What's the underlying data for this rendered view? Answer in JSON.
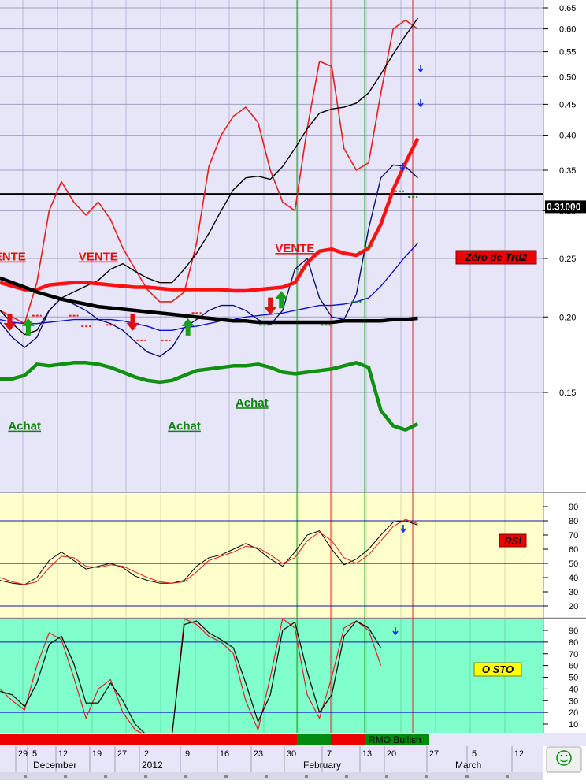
{
  "chart_data": [
    {
      "type": "line",
      "panel": "price",
      "y_scale": "log",
      "ylim": [
        0.1,
        0.66
      ],
      "y_ticks": [
        "0.65",
        "0.60",
        "0.55",
        "0.50",
        "0.45",
        "0.40",
        "0.35",
        "0.30",
        "0.25",
        "0.20",
        "0.15"
      ],
      "y_tick_values": [
        0.65,
        0.6,
        0.55,
        0.5,
        0.45,
        0.4,
        0.35,
        0.3,
        0.25,
        0.2,
        0.15
      ],
      "price_label": "0.31000",
      "price_level": 0.31,
      "legend": "Zéro de Trd2",
      "series": [
        {
          "color": "#e02020",
          "values": [
            0.205,
            0.2,
            0.195,
            0.228,
            0.3,
            0.335,
            0.31,
            0.295,
            0.31,
            0.29,
            0.26,
            0.24,
            0.222,
            0.212,
            0.212,
            0.22,
            0.265,
            0.355,
            0.4,
            0.43,
            0.445,
            0.42,
            0.35,
            0.31,
            0.3,
            0.41,
            0.53,
            0.52,
            0.38,
            0.35,
            0.36,
            0.47,
            0.6,
            0.62,
            0.6
          ]
        },
        {
          "color": "#000000",
          "values": [
            0.205,
            0.195,
            0.187,
            0.19,
            0.205,
            0.215,
            0.22,
            0.225,
            0.23,
            0.24,
            0.245,
            0.238,
            0.232,
            0.228,
            0.228,
            0.24,
            0.255,
            0.275,
            0.3,
            0.325,
            0.34,
            0.342,
            0.338,
            0.355,
            0.38,
            0.41,
            0.435,
            0.442,
            0.445,
            0.452,
            0.47,
            0.505,
            0.545,
            0.585,
            0.625
          ]
        },
        {
          "color": "#1010d0",
          "values": [
            0.198,
            0.196,
            0.195,
            0.195,
            0.196,
            0.197,
            0.198,
            0.198,
            0.198,
            0.198,
            0.197,
            0.195,
            0.193,
            0.19,
            0.19,
            0.192,
            0.193,
            0.195,
            0.197,
            0.198,
            0.2,
            0.201,
            0.202,
            0.203,
            0.205,
            0.207,
            0.209,
            0.209,
            0.21,
            0.212,
            0.215,
            0.225,
            0.238,
            0.252,
            0.265
          ]
        },
        {
          "color": "#101070",
          "values": [
            0.196,
            0.185,
            0.178,
            0.185,
            0.205,
            0.215,
            0.21,
            0.205,
            0.198,
            0.195,
            0.19,
            0.182,
            0.175,
            0.172,
            0.178,
            0.192,
            0.198,
            0.205,
            0.209,
            0.209,
            0.205,
            0.198,
            0.194,
            0.205,
            0.24,
            0.25,
            0.215,
            0.2,
            0.198,
            0.218,
            0.28,
            0.34,
            0.357,
            0.355,
            0.34
          ]
        },
        {
          "color": "#ff1010",
          "values": [
            0.228,
            0.225,
            0.222,
            0.222,
            0.226,
            0.227,
            0.228,
            0.228,
            0.227,
            0.226,
            0.225,
            0.224,
            0.224,
            0.223,
            0.222,
            0.222,
            0.222,
            0.222,
            0.222,
            0.221,
            0.221,
            0.222,
            0.223,
            0.224,
            0.228,
            0.246,
            0.257,
            0.259,
            0.255,
            0.253,
            0.26,
            0.285,
            0.325,
            0.36,
            0.395
          ]
        },
        {
          "color": "#000000",
          "values": [
            0.232,
            0.228,
            0.224,
            0.22,
            0.217,
            0.214,
            0.212,
            0.21,
            0.208,
            0.207,
            0.206,
            0.205,
            0.204,
            0.203,
            0.202,
            0.201,
            0.2,
            0.199,
            0.198,
            0.197,
            0.197,
            0.196,
            0.196,
            0.196,
            0.196,
            0.196,
            0.196,
            0.196,
            0.197,
            0.197,
            0.197,
            0.197,
            0.198,
            0.198,
            0.199
          ]
        },
        {
          "color": "#109010",
          "values": [
            0.158,
            0.158,
            0.16,
            0.167,
            0.166,
            0.167,
            0.168,
            0.168,
            0.167,
            0.165,
            0.162,
            0.159,
            0.157,
            0.156,
            0.157,
            0.16,
            0.163,
            0.164,
            0.165,
            0.166,
            0.166,
            0.167,
            0.165,
            0.162,
            0.161,
            0.162,
            0.163,
            0.164,
            0.166,
            0.168,
            0.165,
            0.14,
            0.132,
            0.13,
            0.133
          ]
        }
      ],
      "signals": [
        {
          "text": "VENTE",
          "color": "#e01010",
          "x": 0.5,
          "price": 0.248
        },
        {
          "text": "VENTE",
          "color": "#e01010",
          "x": 8.0,
          "price": 0.248
        },
        {
          "text": "VENTE",
          "color": "#e01010",
          "x": 24.0,
          "price": 0.256
        },
        {
          "text": "Achat",
          "color": "#108010",
          "x": 20.5,
          "price": 0.142
        },
        {
          "text": "Achat",
          "color": "#108010",
          "x": 2.0,
          "price": 0.13
        },
        {
          "text": "Achat",
          "color": "#108010",
          "x": 15.0,
          "price": 0.13
        }
      ],
      "arrows": [
        {
          "dir": "down",
          "color": "#e01010",
          "x": 0.8,
          "price": 0.192
        },
        {
          "dir": "up",
          "color": "#18a018",
          "x": 2.3,
          "price": 0.192
        },
        {
          "dir": "down",
          "color": "#e01010",
          "x": 10.8,
          "price": 0.192
        },
        {
          "dir": "up",
          "color": "#18a018",
          "x": 15.3,
          "price": 0.192
        },
        {
          "dir": "down",
          "color": "#e01010",
          "x": 22.0,
          "price": 0.204
        },
        {
          "dir": "up",
          "color": "#18a018",
          "x": 22.9,
          "price": 0.213
        }
      ]
    },
    {
      "type": "line",
      "panel": "rsi",
      "legend": "RSI",
      "ylim": [
        10,
        100
      ],
      "y_ticks": [
        "90",
        "80",
        "70",
        "60",
        "50",
        "40",
        "30",
        "20"
      ],
      "y_tick_values": [
        90,
        80,
        70,
        60,
        50,
        40,
        30,
        20
      ],
      "levels": [
        80,
        50,
        20
      ],
      "series": [
        {
          "color": "#000000",
          "values": [
            38,
            36,
            35,
            40,
            52,
            58,
            52,
            46,
            48,
            50,
            47,
            41,
            38,
            36,
            36,
            38,
            48,
            54,
            56,
            60,
            64,
            60,
            53,
            48,
            58,
            70,
            73,
            60,
            49,
            53,
            60,
            70,
            79,
            80,
            77
          ]
        },
        {
          "color": "#e02020",
          "values": [
            40,
            37,
            35,
            37,
            47,
            55,
            54,
            48,
            47,
            49,
            48,
            44,
            40,
            37,
            36,
            37,
            44,
            52,
            55,
            58,
            62,
            61,
            56,
            50,
            54,
            66,
            72,
            66,
            54,
            50,
            56,
            66,
            76,
            81,
            78
          ]
        }
      ]
    },
    {
      "type": "line",
      "panel": "stochastic",
      "legend": "O STO",
      "ylim": [
        0,
        105
      ],
      "y_ticks": [
        "90",
        "80",
        "70",
        "60",
        "50",
        "40",
        "30",
        "20",
        "10"
      ],
      "y_tick_values": [
        90,
        80,
        70,
        60,
        50,
        40,
        30,
        20,
        10
      ],
      "levels": [
        80,
        20
      ],
      "series": [
        {
          "color": "#e02020",
          "values": [
            40,
            30,
            22,
            60,
            88,
            82,
            50,
            15,
            40,
            48,
            20,
            5,
            0,
            0,
            0,
            100,
            95,
            85,
            80,
            70,
            30,
            5,
            50,
            100,
            92,
            35,
            15,
            50,
            92,
            98,
            90,
            60
          ]
        },
        {
          "color": "#000000",
          "values": [
            38,
            35,
            25,
            45,
            78,
            85,
            62,
            28,
            28,
            45,
            30,
            10,
            0,
            0,
            0,
            95,
            98,
            88,
            82,
            75,
            45,
            12,
            35,
            90,
            97,
            55,
            20,
            35,
            85,
            98,
            92,
            75
          ]
        }
      ]
    }
  ],
  "x_labels": [
    "29",
    "5",
    "12",
    "19",
    "27",
    "2",
    "9",
    "16",
    "23",
    "30",
    "7",
    "13",
    "20",
    "27",
    "5",
    "12"
  ],
  "x_months": [
    "December",
    "2012",
    "February",
    "March"
  ],
  "rmo_label": "RMO Bullish",
  "status_colors": {
    "bear": "#ee0000",
    "bull": "#008a10"
  },
  "icons": {
    "smiley": "smiley-icon",
    "signal_arrow": "blue-down-arrow-icon"
  }
}
